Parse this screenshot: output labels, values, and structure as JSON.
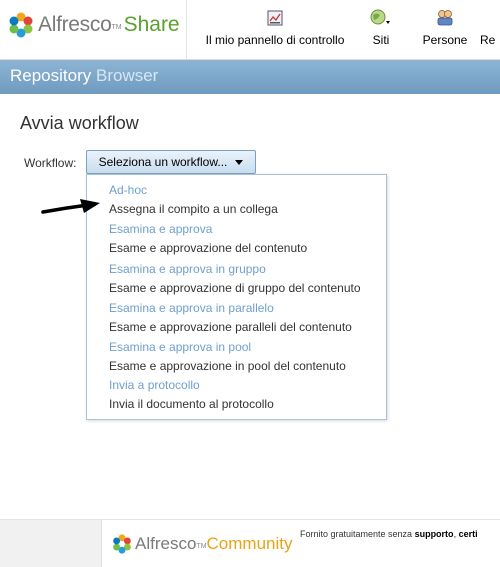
{
  "header": {
    "logo": {
      "brand": "Alfresco",
      "tm": "TM",
      "product": "Share"
    },
    "nav": [
      {
        "label": "Il mio pannello di controllo",
        "icon": "dashboard-icon"
      },
      {
        "label": "Siti",
        "icon": "sites-globe-icon"
      },
      {
        "label": "Persone",
        "icon": "people-icon"
      },
      {
        "label": "Re",
        "icon": "repository-icon"
      }
    ]
  },
  "titlebar": {
    "part1": "Repository",
    "part2": "Browser"
  },
  "main": {
    "heading": "Avvia workflow",
    "workflow_label": "Workflow:",
    "select_button": "Seleziona un workflow..."
  },
  "menu": {
    "items": [
      {
        "title": "Ad-hoc",
        "desc": "Assegna il compito a un collega"
      },
      {
        "title": "Esamina e approva",
        "desc": "Esame e approvazione del contenuto"
      },
      {
        "title": "Esamina e approva in gruppo",
        "desc": "Esame e approvazione di gruppo del contenuto"
      },
      {
        "title": "Esamina e approva in parallelo",
        "desc": "Esame e approvazione paralleli del contenuto"
      },
      {
        "title": "Esamina e approva in pool",
        "desc": "Esame e approvazione in pool del contenuto"
      },
      {
        "title": "Invia a protocollo",
        "desc": "Invia il documento al protocollo"
      }
    ]
  },
  "footer": {
    "logo": {
      "brand": "Alfresco",
      "tm": "TM",
      "product": "Community"
    },
    "text_prefix": "Fornito gratuitamente senza ",
    "text_bold1": "supporto",
    "text_mid": ", ",
    "text_bold2": "certi"
  },
  "colors": {
    "titlebar": "#7ba5c9",
    "menu_title": "#6fa0cc",
    "share_green": "#5aa02c",
    "community_orange": "#e8a317"
  }
}
